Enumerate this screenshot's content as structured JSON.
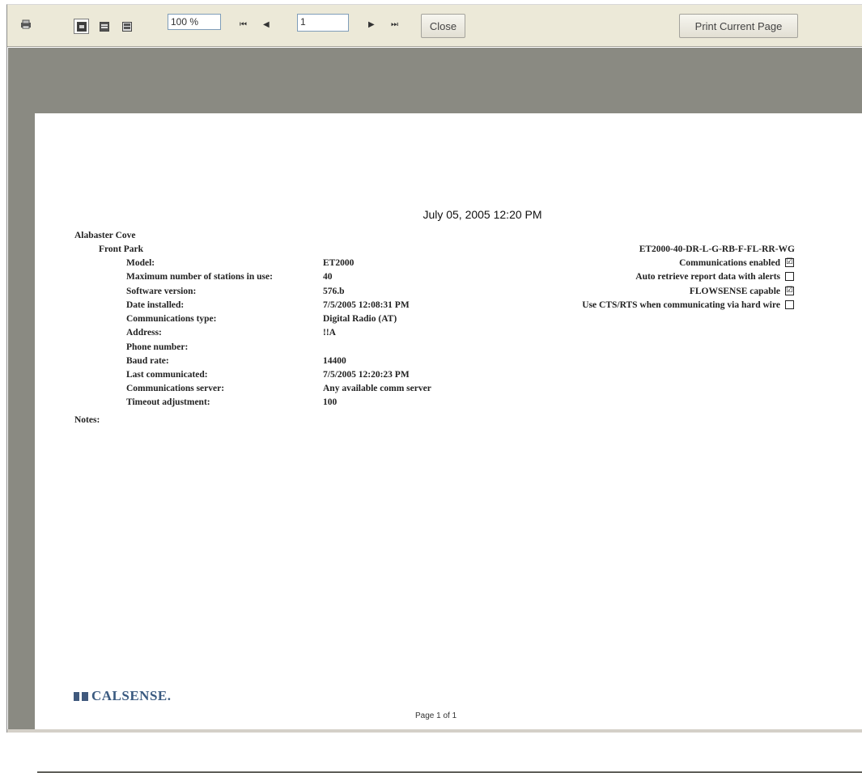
{
  "toolbar": {
    "print_icon": "printer-icon",
    "zoom": "100 %",
    "page_input": "1",
    "first_glyph": "⏮",
    "prev_glyph": "◀",
    "next_glyph": "▶",
    "last_glyph": "⏭",
    "close_label": "Close",
    "print_current_label": "Print Current Page"
  },
  "report": {
    "date": "July 05, 2005 12:20 PM",
    "site": "Alabaster Cove",
    "controller": "Front Park",
    "model_code": "ET2000-40-DR-L-G-RB-F-FL-RR-WG",
    "fields": [
      {
        "label": "Model:",
        "value": "ET2000"
      },
      {
        "label": "Maximum number of stations in use:",
        "value": "40"
      },
      {
        "label": "Software version:",
        "value": "576.b"
      },
      {
        "label": "Date installed:",
        "value": "7/5/2005 12:08:31 PM"
      },
      {
        "label": "Communications type:",
        "value": "Digital Radio (AT)"
      },
      {
        "label": "Address:",
        "value": "!!A"
      },
      {
        "label": "Phone number:",
        "value": ""
      },
      {
        "label": "Baud rate:",
        "value": "14400"
      },
      {
        "label": "Last communicated:",
        "value": "7/5/2005 12:20:23 PM"
      },
      {
        "label": "Communications server:",
        "value": "Any available comm server"
      },
      {
        "label": "Timeout adjustment:",
        "value": "100"
      }
    ],
    "options": [
      {
        "label": "Communications enabled",
        "checked": true
      },
      {
        "label": "Auto retrieve report data with alerts",
        "checked": false
      },
      {
        "label": "FLOWSENSE capable",
        "checked": true
      },
      {
        "label": "Use CTS/RTS when communicating via hard wire",
        "checked": false
      }
    ],
    "options_checked": [
      "☑",
      "",
      "☑",
      ""
    ],
    "notes_label": "Notes:",
    "logo_text": "CALSENSE.",
    "footer": "Page 1 of 1"
  }
}
